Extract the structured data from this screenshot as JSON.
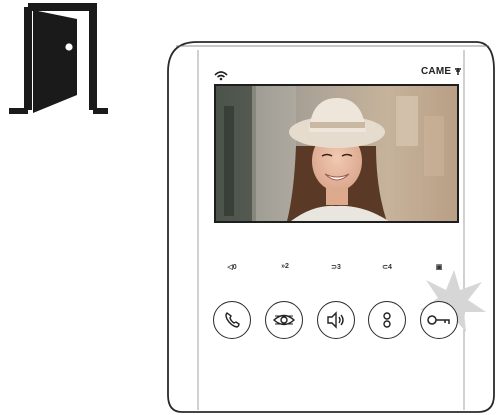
{
  "device": {
    "brand": "CAME",
    "buttons": [
      {
        "label": "◁0",
        "icon": "handset-icon"
      },
      {
        "label": "»2",
        "icon": "eye-camera-icon"
      },
      {
        "label": "⊃3",
        "icon": "speaker-icon"
      },
      {
        "label": "⊂4",
        "icon": "intercom-icon"
      },
      {
        "label": "▣",
        "icon": "key-icon"
      }
    ],
    "active_button": 4
  },
  "colors": {
    "outline": "#1e1e1e",
    "burst": "#d6d6d6"
  }
}
